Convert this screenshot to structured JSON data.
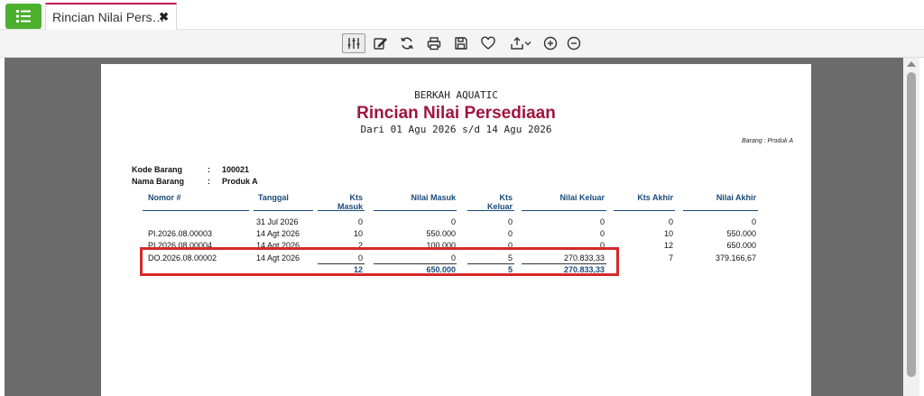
{
  "tab": {
    "title": "Rincian Nilai Pers…"
  },
  "toolbar": {
    "items": [
      {
        "name": "filter-settings-icon"
      },
      {
        "name": "edit-icon"
      },
      {
        "name": "refresh-icon"
      },
      {
        "name": "print-icon"
      },
      {
        "name": "save-icon"
      },
      {
        "name": "favorite-heart-icon"
      },
      {
        "name": "export-icon"
      },
      {
        "name": "zoom-in-icon"
      },
      {
        "name": "zoom-out-icon"
      }
    ]
  },
  "report": {
    "company": "BERKAH AQUATIC",
    "title": "Rincian Nilai Persediaan",
    "period": "Dari 01 Agu 2026 s/d 14 Agu 2026",
    "barang_note": "Barang : Produk A",
    "kode_label": "Kode Barang",
    "kode_value": "100021",
    "nama_label": "Nama Barang",
    "nama_value": "Produk A",
    "colon": ":",
    "columns": {
      "nomor": "Nomor #",
      "tanggal": "Tanggal",
      "kts_masuk_1": "Kts",
      "kts_masuk_2": "Masuk",
      "nilai_masuk": "Nilai Masuk",
      "kts_keluar_1": "Kts",
      "kts_keluar_2": "Keluar",
      "nilai_keluar": "Nilai Keluar",
      "kts_akhir": "Kts Akhir",
      "nilai_akhir": "Nilai Akhir"
    },
    "rows": [
      {
        "nomor": "",
        "tanggal": "31 Jul 2026",
        "kts_masuk": "0",
        "nilai_masuk": "0",
        "kts_keluar": "0",
        "nilai_keluar": "0",
        "kts_akhir": "0",
        "nilai_akhir": "0"
      },
      {
        "nomor": "PI.2026.08.00003",
        "tanggal": "14 Agt 2026",
        "kts_masuk": "10",
        "nilai_masuk": "550.000",
        "kts_keluar": "0",
        "nilai_keluar": "0",
        "kts_akhir": "10",
        "nilai_akhir": "550.000"
      },
      {
        "nomor": "PI.2026.08.00004",
        "tanggal": "14 Agt 2026",
        "kts_masuk": "2",
        "nilai_masuk": "100.000",
        "kts_keluar": "0",
        "nilai_keluar": "0",
        "kts_akhir": "12",
        "nilai_akhir": "650.000"
      },
      {
        "nomor": "DO.2026.08.00002",
        "tanggal": "14 Agt 2026",
        "kts_masuk": "0",
        "nilai_masuk": "0",
        "kts_keluar": "5",
        "nilai_keluar": "270.833,33",
        "kts_akhir": "7",
        "nilai_akhir": "379.166,67"
      }
    ],
    "totals": {
      "kts_masuk": "12",
      "nilai_masuk": "650.000",
      "kts_keluar": "5",
      "nilai_keluar": "270.833,33"
    }
  },
  "colors": {
    "accent_green": "#4caf2e",
    "tab_accent": "#c2185b",
    "title": "#a0153e",
    "header_blue": "#1a4a7a",
    "highlight_red": "#d62828"
  }
}
